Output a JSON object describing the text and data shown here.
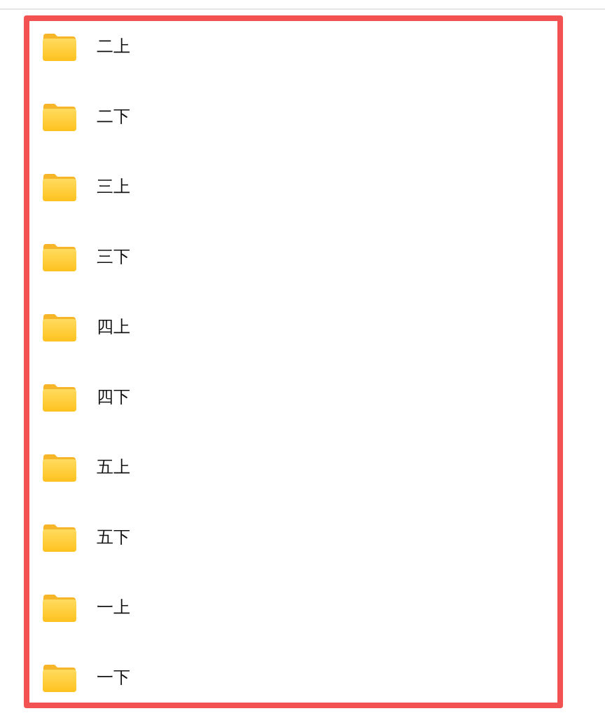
{
  "folders": [
    {
      "name": "二上"
    },
    {
      "name": "二下"
    },
    {
      "name": "三上"
    },
    {
      "name": "三下"
    },
    {
      "name": "四上"
    },
    {
      "name": "四下"
    },
    {
      "name": "五上"
    },
    {
      "name": "五下"
    },
    {
      "name": "一上"
    },
    {
      "name": "一下"
    }
  ]
}
